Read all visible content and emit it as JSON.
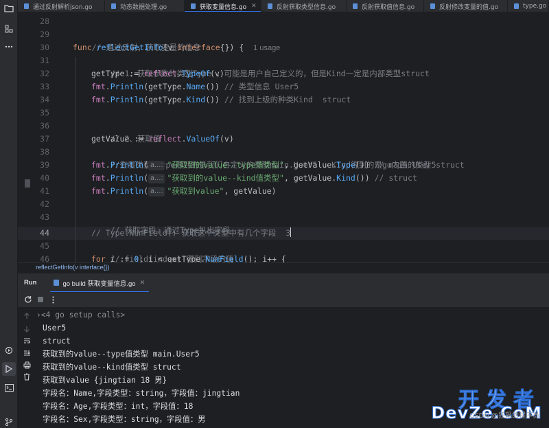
{
  "tabs": [
    {
      "label": "通过反射解析json.go",
      "active": false
    },
    {
      "label": "动态数据处理.go",
      "active": false
    },
    {
      "label": "获取变量信息.go",
      "active": true
    },
    {
      "label": "反射获取类型信息.go",
      "active": false
    },
    {
      "label": "反射获取值信息.go",
      "active": false
    },
    {
      "label": "反射修改变量的值.go",
      "active": false
    },
    {
      "label": "type.go",
      "active": false
    }
  ],
  "editor": {
    "line_numbers": [
      "28",
      "29",
      "30",
      "31",
      "32",
      "33",
      "34",
      "35",
      "36",
      "37",
      "38",
      "39",
      "40",
      "41",
      "42",
      "43",
      "44",
      "45",
      "46"
    ],
    "current_line": "44",
    "usage_hint": "1 usage",
    "param_hint": "a…:",
    "lines": {
      "l29": "// 通过反射，获取变量的信息",
      "l30": {
        "kw": "func",
        "name": "reflectGetInfo",
        "sig_open": "(v ",
        "kw2": "interface",
        "sig_close": "{}) {"
      },
      "l31": "// 1、获取参数的类型Type ，可能是用户自己定义的，但是Kind一定是内部类型struct",
      "l32": {
        "pre": "getType := ",
        "pkg": "reflect",
        "dot": ".",
        "fn": "TypeOf",
        "post": "(v)"
      },
      "l33": {
        "pkg": "fmt",
        "dot": ".",
        "fn": "Println",
        "mid": "(getType.",
        "fn2": "Name",
        "post": "()) ",
        "cm": "// 类型信息 User5"
      },
      "l34": {
        "pkg": "fmt",
        "dot": ".",
        "fn": "Println",
        "mid": "(getType.",
        "fn2": "Kind",
        "post": "()) ",
        "cm": "// 找到上级的种类Kind  struct"
      },
      "l36": "// 2、获取值",
      "l37": {
        "pre": "getValue := ",
        "pkg": "reflect",
        "dot": ".",
        "fn": "ValueOf",
        "post": "(v)"
      },
      "l38": "//查看类型 Type得到的是我们自定义的类型main.User5   Kind得到的是go内置的类型 struct",
      "l39": {
        "pkg": "fmt",
        "dot": ".",
        "fn": "Println",
        "open": "(",
        "str": "\"获取到的value--type值类型\"",
        "mid": ", getValue.",
        "fn2": "Type",
        "post": "()) ",
        "cm": "// main.User5"
      },
      "l40": {
        "pkg": "fmt",
        "dot": ".",
        "fn": "Println",
        "open": "(",
        "str": "\"获取到的value--kind值类型\"",
        "mid": ", getValue.",
        "fn2": "Kind",
        "post": "()) ",
        "cm": "// struct"
      },
      "l41": {
        "pkg": "fmt",
        "dot": ".",
        "fn": "Println",
        "open": "(",
        "str": "\"获取到value\"",
        "post": ", getValue)"
      },
      "l43": "// 获取字段，通过Type扒出字段",
      "l44": "// Type.NumField() 获取这个类型中有几个字段  3",
      "l45": "// field(index) 得到字段的值",
      "l46": {
        "kw": "for",
        "mid": " i := ",
        "num": "0",
        "mid2": "; i < getType.",
        "fn": "NumField",
        "post": "(); i++ {"
      }
    }
  },
  "breadcrumb": "reflectGetInfo(v interface{})",
  "run": {
    "title": "Run",
    "tab_label": "go build 获取变量信息.go",
    "setup_calls": "<4 go setup calls>",
    "output": [
      "User5",
      "struct",
      "获取到的value--type值类型 main.User5",
      "获取到的value--kind值类型 struct",
      "获取到value {jingtian 18 男}",
      "字段名：Name,字段类型：string，字段值：jingtian",
      "字段名：Age,字段类型：int，字段值：18",
      "字段名：Sex,字段类型：string，字段值：男"
    ]
  },
  "watermark": {
    "top": "开发者",
    "bottom": "DevZe.CoM",
    "sub": "CSDN @狂飙的程序员"
  },
  "colors": {
    "accent": "#3574f0",
    "keyword": "#cf8e6d",
    "function": "#57aaf7",
    "string": "#6aab73",
    "comment": "#7a7e85"
  }
}
